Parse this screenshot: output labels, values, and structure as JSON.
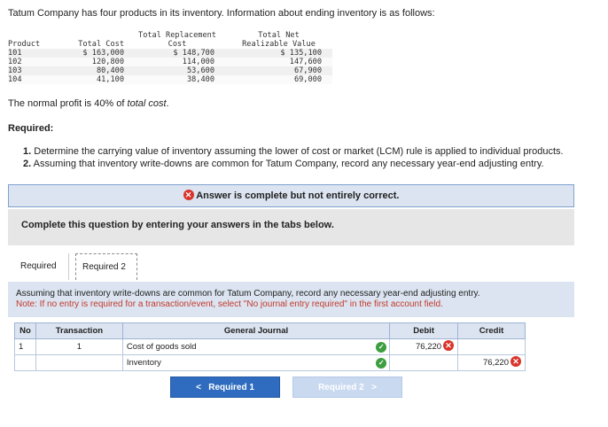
{
  "intro": "Tatum Company has four products in its inventory. Information about ending inventory is as follows:",
  "inventory": {
    "headers": {
      "product": "Product",
      "total_cost": "Total Cost",
      "replacement_line1": "Total Replacement",
      "replacement_line2": "Cost",
      "nrv_line1": "Total Net",
      "nrv_line2": "Realizable Value"
    },
    "rows": [
      {
        "product": "101",
        "total_cost": "$ 163,000",
        "replacement": "$ 148,700",
        "nrv": "$ 135,100"
      },
      {
        "product": "102",
        "total_cost": "120,800",
        "replacement": "114,000",
        "nrv": "147,600"
      },
      {
        "product": "103",
        "total_cost": "80,400",
        "replacement": "53,600",
        "nrv": "67,900"
      },
      {
        "product": "104",
        "total_cost": "41,100",
        "replacement": "38,400",
        "nrv": "69,000"
      }
    ]
  },
  "profit": {
    "prefix": "The normal profit is 40% of ",
    "emph": "total cost",
    "suffix": "."
  },
  "required_heading": "Required:",
  "requirements": [
    {
      "num": "1.",
      "text": "Determine the carrying value of inventory assuming the lower of cost or market (LCM) rule is applied to individual products."
    },
    {
      "num": "2.",
      "text": "Assuming that inventory write-downs are common for Tatum Company, record any necessary year-end adjusting entry."
    }
  ],
  "banner": {
    "icon": "x-circle-icon",
    "text": "Answer is complete but not entirely correct."
  },
  "complete_text": "Complete this question by entering your answers in the tabs below.",
  "tabs": [
    {
      "label": "Required 1",
      "active": false
    },
    {
      "label": "Required 2",
      "active": true
    }
  ],
  "instructions": {
    "text": "Assuming that inventory write-downs are common for Tatum Company, record any necessary year-end adjusting entry.",
    "note": "Note: If no entry is required for a transaction/event, select \"No journal entry required\" in the first account field."
  },
  "journal": {
    "headers": {
      "no": "No",
      "transaction": "Transaction",
      "general_journal": "General Journal",
      "debit": "Debit",
      "credit": "Credit"
    },
    "rows": [
      {
        "no": "1",
        "transaction": "1",
        "account": "Cost of goods sold",
        "debit": "76,220",
        "credit": "",
        "account_status": "correct",
        "debit_status": "incorrect"
      },
      {
        "no": "",
        "transaction": "",
        "account": "Inventory",
        "debit": "",
        "credit": "76,220",
        "account_status": "correct",
        "credit_status": "incorrect"
      }
    ]
  },
  "nav": {
    "prev_label": "Required 1",
    "next_label": "Required 2",
    "prev_arrow": "<",
    "next_arrow": ">"
  },
  "colors": {
    "accent": "#2f6cbf",
    "panel": "#dbe4f0",
    "error": "#d9342b",
    "ok": "#3d9e3f",
    "note": "#c2392c"
  }
}
